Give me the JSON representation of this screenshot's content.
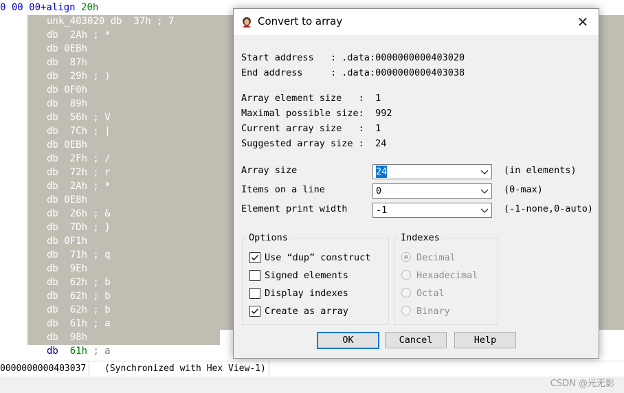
{
  "disassembly": {
    "first_line": {
      "prefix": "0 00 00+align ",
      "value": "20h"
    },
    "label_line": "unk_403020 db  37h ; 7",
    "lines": [
      "db  2Ah ; *",
      "db 0EBh",
      "db  87h",
      "db  29h ; )",
      "db 0F0h",
      "db  89h",
      "db  56h ; V",
      "db  7Ch ; |",
      "db 0EBh",
      "db  2Fh ; /",
      "db  72h ; r",
      "db  2Ah ; *",
      "db 0E8h",
      "db  26h ; &",
      "db  7Dh ; }",
      "db 0F1h",
      "db  71h ; q",
      "db  9Eh",
      "db  62h ; b",
      "db  62h ; b",
      "db  62h ; b",
      "db  61h ; a",
      "db  98h"
    ],
    "last_line": {
      "op": "db",
      "value": "61h",
      "comment": "; a"
    }
  },
  "statusbar": {
    "address": "0000000000403037",
    "sync": "(Synchronized with Hex View-1)"
  },
  "watermark": "CSDN @光无影",
  "dialog": {
    "title": "Convert to array",
    "close_glyph": "✕",
    "info": [
      "Start address   : .data:0000000000403020",
      "End address     : .data:0000000000403038"
    ],
    "sizes": [
      "Array element size   :  1",
      "Maximal possible size:  992",
      "Current array size   :  1",
      "Suggested array size :  24"
    ],
    "fields": {
      "array_size": {
        "label": "Array size",
        "value": "24",
        "hint": "(in elements)"
      },
      "items_on_line": {
        "label": "Items on a line",
        "value": "0",
        "hint": "(0-max)"
      },
      "print_width": {
        "label": "Element print width",
        "value": "-1",
        "hint": "(-1-none,0-auto)"
      }
    },
    "options": {
      "title": "Options",
      "items": [
        {
          "label": "Use “dup” construct",
          "checked": true
        },
        {
          "label": "Signed elements",
          "checked": false
        },
        {
          "label": "Display indexes",
          "checked": false
        },
        {
          "label": "Create as array",
          "checked": true
        }
      ]
    },
    "indexes": {
      "title": "Indexes",
      "items": [
        {
          "label": "Decimal",
          "selected": true
        },
        {
          "label": "Hexadecimal",
          "selected": false
        },
        {
          "label": "Octal",
          "selected": false
        },
        {
          "label": "Binary",
          "selected": false
        }
      ]
    },
    "buttons": {
      "ok": "OK",
      "cancel": "Cancel",
      "help": "Help"
    }
  }
}
